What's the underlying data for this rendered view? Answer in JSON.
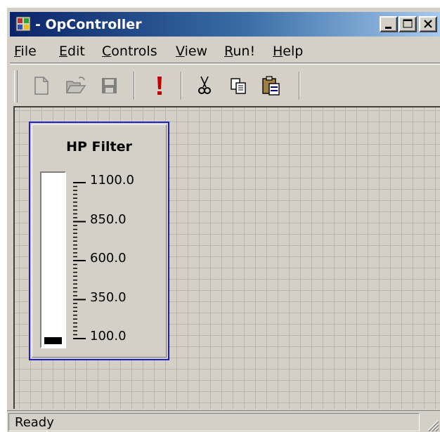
{
  "window": {
    "title": "- OpController",
    "app_icon": "app-icon",
    "caption_buttons": [
      "minimize-icon",
      "maximize-icon",
      "close-icon"
    ]
  },
  "menu": {
    "items": [
      {
        "label": "File",
        "hotkey": "F",
        "rest": "ile"
      },
      {
        "label": "Edit",
        "hotkey": "E",
        "rest": "dit"
      },
      {
        "label": "Controls",
        "hotkey": "C",
        "rest": "ontrols"
      },
      {
        "label": "View",
        "hotkey": "V",
        "rest": "iew"
      },
      {
        "label": "Run!",
        "hotkey": "R",
        "rest": "un!"
      },
      {
        "label": "Help",
        "hotkey": "H",
        "rest": "elp"
      }
    ]
  },
  "toolbar": {
    "buttons": [
      "new-file-icon",
      "open-folder-icon",
      "save-disk-icon",
      "run-exclamation-icon",
      "cut-scissors-icon",
      "copy-icon",
      "paste-clipboard-icon"
    ],
    "colors": {
      "run": "#c00000",
      "disabled": "#808080"
    }
  },
  "control": {
    "title": "HP Filter",
    "scale_labels": [
      "1100.0",
      "850.0",
      "600.0",
      "350.0",
      "100.0"
    ],
    "min": 100.0,
    "max": 1100.0,
    "value_fraction": 0.02,
    "border_color": "#2020c0"
  },
  "status": {
    "text": "Ready"
  }
}
